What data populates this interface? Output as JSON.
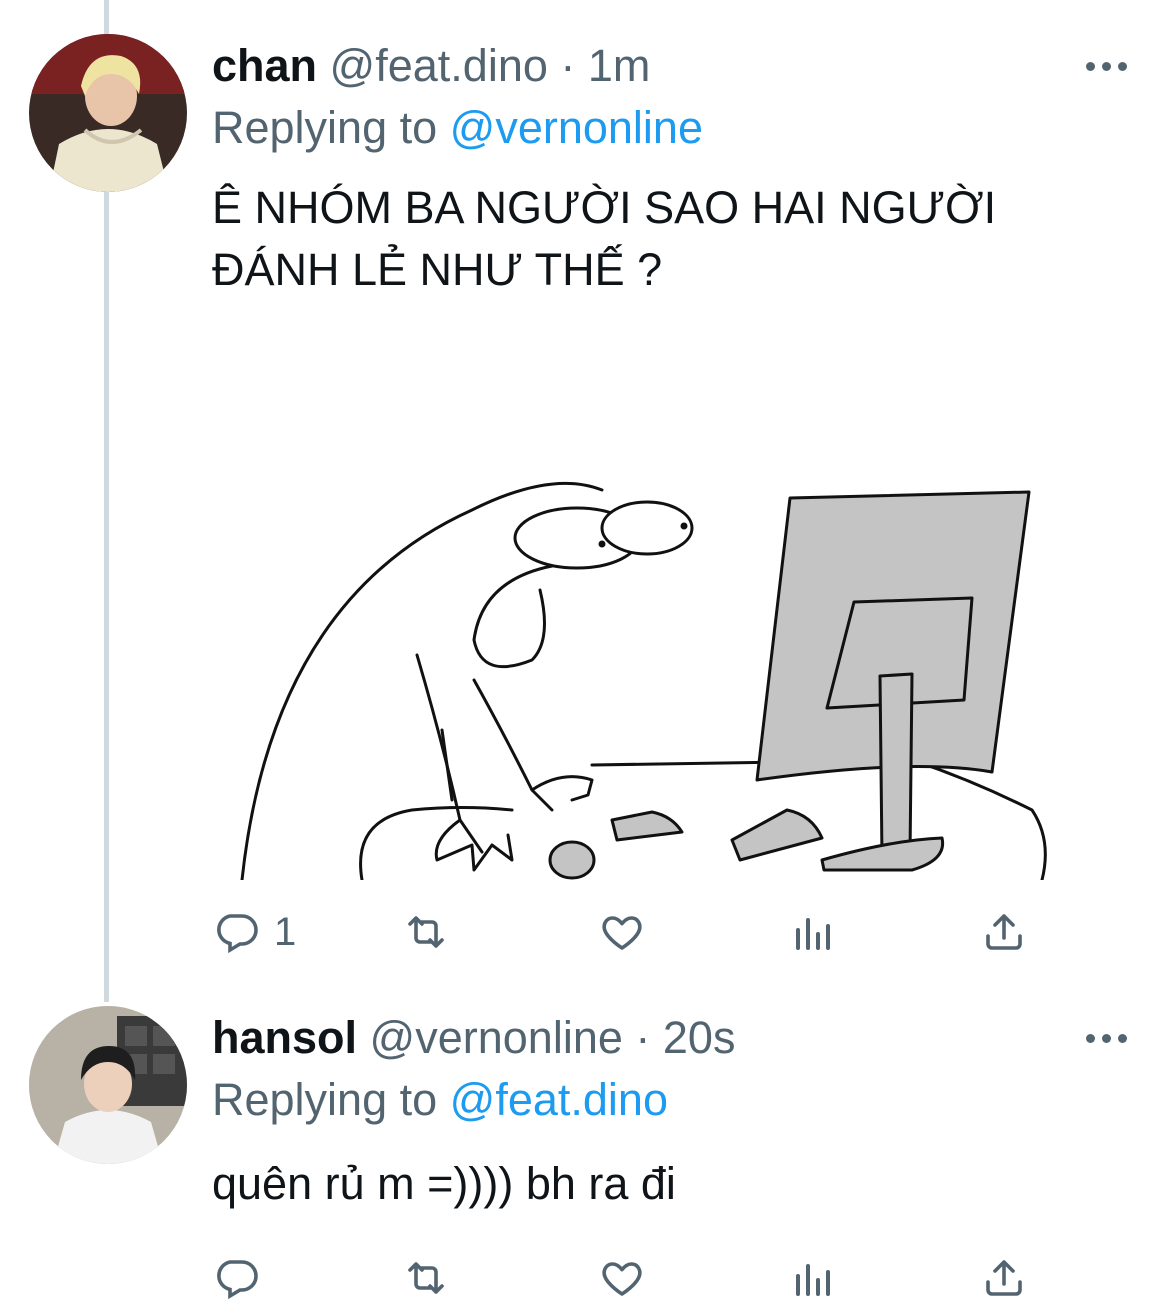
{
  "tweets": [
    {
      "display_name": "chan",
      "handle": "@feat.dino",
      "separator": "·",
      "time": "1m",
      "replying_prefix": "Replying to",
      "replying_to": "@vernonline",
      "text_line1": "Ê NHÓM BA NGƯỜI SAO HAI NGƯỜI",
      "text_line2": "ĐÁNH LẺ NHƯ THẾ ?",
      "has_media": true,
      "reply_count": "1",
      "retweet_count": "",
      "like_count": ""
    },
    {
      "display_name": "hansol",
      "handle": "@vernonline",
      "separator": "·",
      "time": "20s",
      "replying_prefix": "Replying to",
      "replying_to": "@feat.dino",
      "text_line1": "quên rủ m =)))) bh ra đi",
      "has_media": false,
      "reply_count": "",
      "retweet_count": "",
      "like_count": ""
    }
  ],
  "icons": {
    "reply": "reply-icon",
    "retweet": "retweet-icon",
    "like": "heart-icon",
    "analytics": "analytics-icon",
    "share": "share-icon",
    "more": "more-icon"
  },
  "colors": {
    "text": "#0f1419",
    "muted": "#536471",
    "link": "#1d9bf0",
    "thread_line": "#cfd9de",
    "drawing_fill": "#c4c4c4"
  }
}
